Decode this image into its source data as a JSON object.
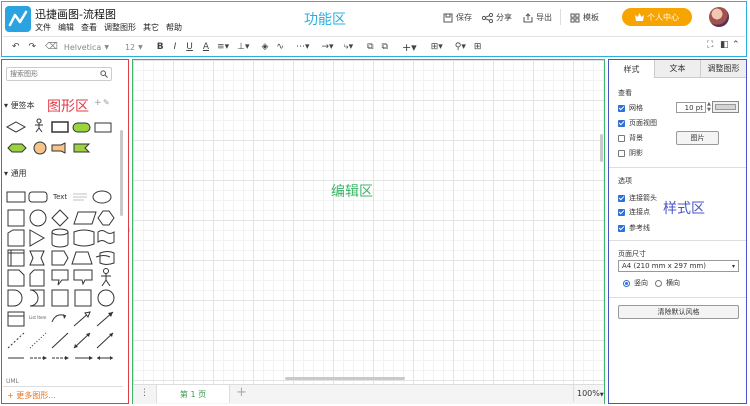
{
  "app": {
    "title": "迅捷画图-流程图",
    "logo_color": "#2aa3e0"
  },
  "menu": [
    "文件",
    "编辑",
    "查看",
    "调整图形",
    "其它",
    "帮助"
  ],
  "header_actions": {
    "save": "保存",
    "share": "分享",
    "export": "导出",
    "template": "模板",
    "user_center": "个人中心"
  },
  "toolbar": {
    "font": "Helvetica",
    "font_size": "12"
  },
  "region_labels": {
    "function": "功能区",
    "shapes": "图形区",
    "editor": "编辑区",
    "style": "样式区"
  },
  "colors": {
    "function": "#2ab0e0",
    "shapes": "#e63946",
    "editor": "#3cb56a",
    "style": "#4b54c8",
    "accent": "#f7a400"
  },
  "left_panel": {
    "search_placeholder": "搜索图形",
    "section_favorites": "便签本",
    "section_general": "通用",
    "more_shapes": "+ 更多图形...",
    "text_shape": "Text",
    "list_item": "List Item",
    "uml": "UML"
  },
  "canvas": {
    "page_tab": "第 1 页",
    "zoom": "100%"
  },
  "right_panel": {
    "tabs": [
      "样式",
      "文本",
      "调整图形"
    ],
    "view_title": "查看",
    "grid": "网格",
    "grid_size": "10 pt",
    "page_view": "页面视图",
    "background": "背景",
    "image_button": "图片",
    "shadow": "阴影",
    "options_title": "选项",
    "connection_arrows": "连接箭头",
    "connection_points": "连接点",
    "guides": "参考线",
    "page_size_title": "页面尺寸",
    "page_size_value": "A4 (210 mm x 297 mm)",
    "portrait": "竖向",
    "landscape": "横向",
    "reset_style": "清除默认风格"
  }
}
